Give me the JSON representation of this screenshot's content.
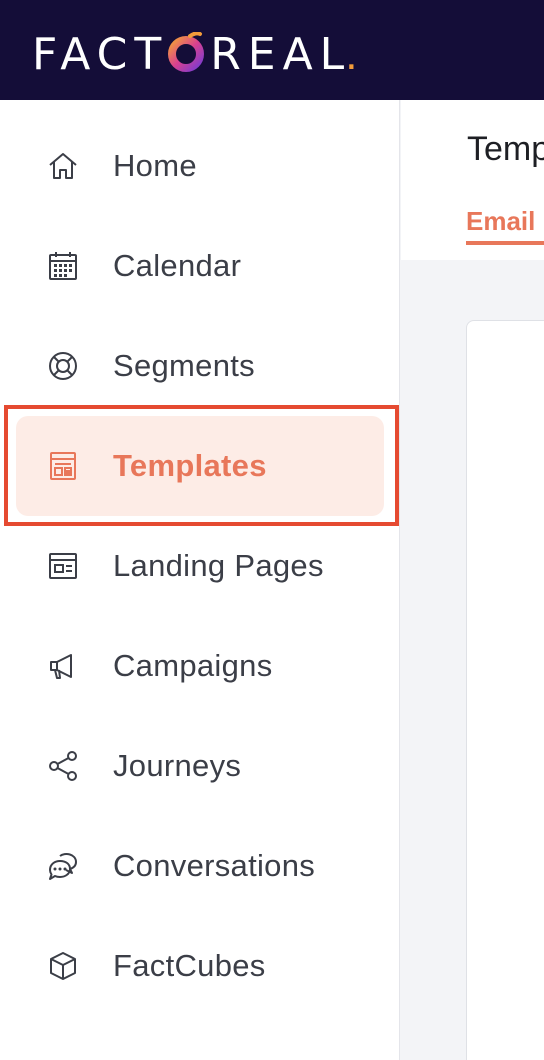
{
  "brand": {
    "logo_text_left": "FACT",
    "logo_text_right": "REAL",
    "logo_dot": ".",
    "accent_color": "#e8775a",
    "topbar_color": "#140d38",
    "highlight_color": "#e54a31"
  },
  "sidebar": {
    "items": [
      {
        "label": "Home",
        "icon": "home-icon"
      },
      {
        "label": "Calendar",
        "icon": "calendar-icon"
      },
      {
        "label": "Segments",
        "icon": "segments-icon"
      },
      {
        "label": "Templates",
        "icon": "templates-icon",
        "active": true
      },
      {
        "label": "Landing Pages",
        "icon": "landing-pages-icon"
      },
      {
        "label": "Campaigns",
        "icon": "megaphone-icon"
      },
      {
        "label": "Journeys",
        "icon": "share-icon"
      },
      {
        "label": "Conversations",
        "icon": "chat-icon"
      },
      {
        "label": "FactCubes",
        "icon": "cube-icon"
      }
    ]
  },
  "main": {
    "title": "Temp",
    "tabs": [
      {
        "label": "Email",
        "active": true
      }
    ]
  }
}
